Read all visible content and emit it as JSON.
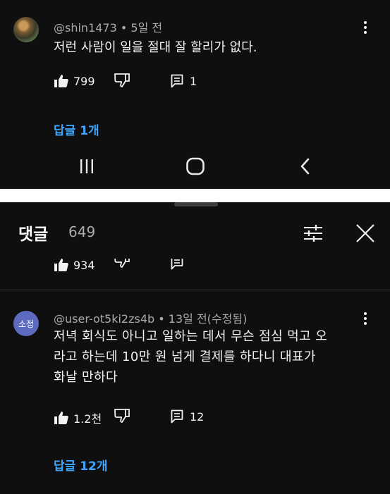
{
  "comment_top": {
    "handle": "@shin1473",
    "separator": "•",
    "time": "5일 전",
    "text": "저런 사람이 일을 절대 잘 할리가 없다.",
    "likes": "799",
    "replies_count": "1",
    "reply_link": "답글 1개"
  },
  "comments_header": {
    "title": "댓글",
    "count": "649"
  },
  "partial_comment": {
    "likes": "934"
  },
  "comment_main": {
    "avatar_text": "소정",
    "handle": "@user-ot5ki2zs4b",
    "separator": "•",
    "time": "13일 전(수정됨)",
    "text_lines": [
      "저녁 회식도 아니고 일하는 데서 무슨 점심 먹고 오",
      "라고 하는데 10만 원 넘게 결제를 하다니 대표가",
      "화날 만하다"
    ],
    "likes": "1.2천",
    "replies_count": "12",
    "reply_link": "답글 12개"
  },
  "colors": {
    "background": "#0f0f0f",
    "link": "#3ea6ff",
    "secondary_text": "#aaaaaa",
    "avatar": "#5c6bc0"
  },
  "icons": [
    "thumbs-up-icon",
    "thumbs-down-icon",
    "reply-icon",
    "more-vert-icon",
    "recent-apps-icon",
    "home-icon",
    "back-icon",
    "filter-icon",
    "close-icon"
  ]
}
